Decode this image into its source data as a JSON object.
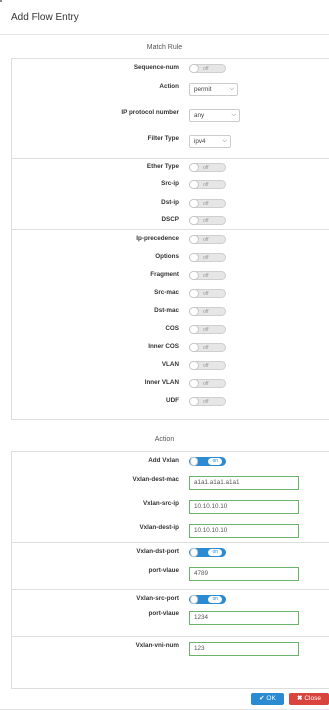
{
  "modal": {
    "title": "Add Flow Entry"
  },
  "match_rule": {
    "title": "Match Rule",
    "sequence": {
      "label": "Sequence-num",
      "state": "off"
    },
    "action": {
      "label": "Action",
      "value": "permit"
    },
    "ip_protocol": {
      "label": "IP protocol number",
      "value": "any"
    },
    "filter_type": {
      "label": "Filter Type",
      "value": "ipv4"
    },
    "toggles": [
      {
        "label": "Ether Type",
        "state": "off"
      },
      {
        "label": "Src-ip",
        "state": "off"
      },
      {
        "label": "Dst-ip",
        "state": "off"
      },
      {
        "label": "DSCP",
        "state": "off"
      },
      {
        "label": "Ip-precedence",
        "state": "off"
      },
      {
        "label": "Options",
        "state": "off"
      },
      {
        "label": "Fragment",
        "state": "off"
      },
      {
        "label": "Src-mac",
        "state": "off"
      },
      {
        "label": "Dst-mac",
        "state": "off"
      },
      {
        "label": "COS",
        "state": "off"
      },
      {
        "label": "Inner COS",
        "state": "off"
      },
      {
        "label": "VLAN",
        "state": "off"
      },
      {
        "label": "Inner VLAN",
        "state": "off"
      },
      {
        "label": "UDF",
        "state": "off"
      }
    ]
  },
  "action_section": {
    "title": "Action",
    "add_vxlan": {
      "label": "Add Vxlan",
      "state": "on"
    },
    "dest_mac": {
      "label": "Vxlan-dest-mac",
      "value": "a1a1.a1a1.a1a1"
    },
    "src_ip": {
      "label": "Vxlan-src-ip",
      "value": "10.10.10.10"
    },
    "dest_ip": {
      "label": "Vxlan-dest-ip",
      "value": "10.10.10.10"
    },
    "dst_port": {
      "label": "Vxlan-dst-port",
      "state": "on"
    },
    "dst_port_value": {
      "label": "port-vlaue",
      "value": "4789"
    },
    "src_port": {
      "label": "Vxlan-src-port",
      "state": "on"
    },
    "src_port_value": {
      "label": "port-vlaue",
      "value": "1234"
    },
    "vni": {
      "label": "Vxlan-vni-num",
      "value": "123"
    }
  },
  "footer": {
    "ok_label": "OK",
    "close_label": "Close",
    "ok_icon": "check-icon",
    "close_icon": "x-icon"
  }
}
